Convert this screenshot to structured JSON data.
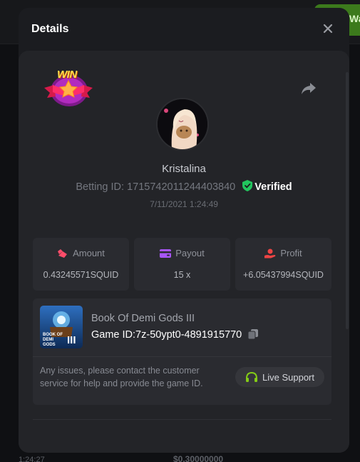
{
  "background": {
    "button_partial_text": "Wa",
    "bottom_time": "1:24:27",
    "bottom_amount": "$0.30000000"
  },
  "modal": {
    "title": "Details"
  },
  "bet": {
    "badge_text": "WIN",
    "username": "Kristalina",
    "betting_id_label": "Betting ID:",
    "betting_id": "1715742011244403840",
    "verified_label": "Verified",
    "timestamp": "7/11/2021 1:24:49"
  },
  "stats": [
    {
      "label": "Amount",
      "value": "0.43245571SQUID",
      "icon": "money-bag-icon",
      "color": "#ff4d6a"
    },
    {
      "label": "Payout",
      "value": "15 x",
      "icon": "wallet-icon",
      "color": "#a855f7"
    },
    {
      "label": "Profit",
      "value": "+6.05437994SQUID",
      "icon": "hand-coin-icon",
      "color": "#ef4444"
    }
  ],
  "game": {
    "name": "Book Of Demi Gods III",
    "id_label": "Game ID:",
    "id": "7z-50ypt0-4891915770",
    "thumb_text": "BOOK OF DEMI GODS",
    "thumb_numeral": "III",
    "issue_text": "Any issues, please contact the customer service for help and provide the game ID.",
    "support_label": "Live Support"
  },
  "colors": {
    "verified_green": "#22c55e",
    "support_green": "#84cc16",
    "modal_bg": "#1b1c20",
    "card_bg": "#2a2b30"
  }
}
